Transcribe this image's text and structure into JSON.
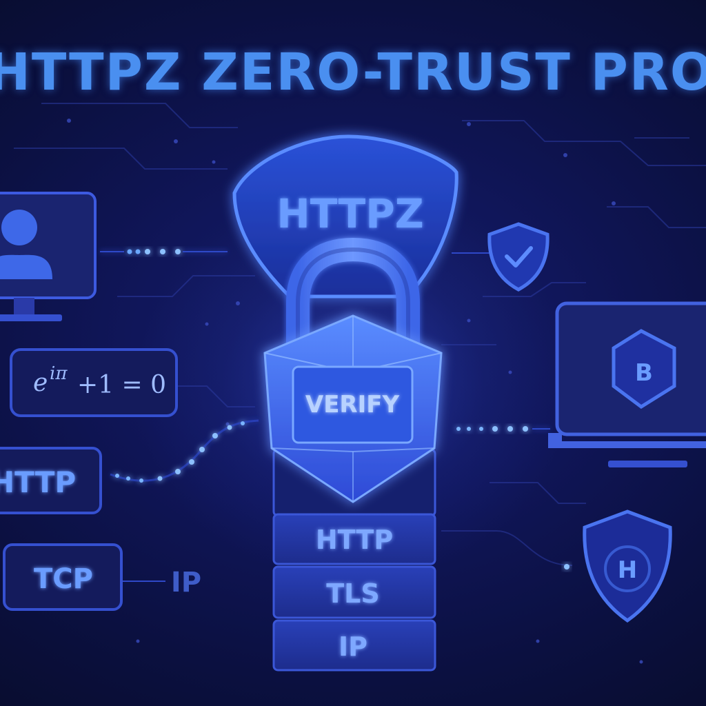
{
  "title": "HTTPZ ZERO-TRUST PROTOCOL",
  "shield_label": "HTTPZ",
  "lock_label": "VERIFY",
  "stack_layers": [
    "HTTP",
    "TLS",
    "IP"
  ],
  "left_boxes": {
    "equation": {
      "e": "e",
      "exponent": "iπ",
      "rest": "+1 = 0"
    },
    "http": "HTTP",
    "tcp": "TCP",
    "ip": "IP"
  },
  "right_icons": {
    "monitor_badge": "B",
    "shield_badge": "H"
  },
  "colors": {
    "background": "#0b1035",
    "accent": "#4a8ff0",
    "glow": "#5fa8ff",
    "panel": "#1a2470"
  },
  "icons": [
    "user-monitor-icon",
    "shield-check-icon",
    "laptop-badge-icon",
    "shield-h-icon",
    "padlock-icon"
  ]
}
